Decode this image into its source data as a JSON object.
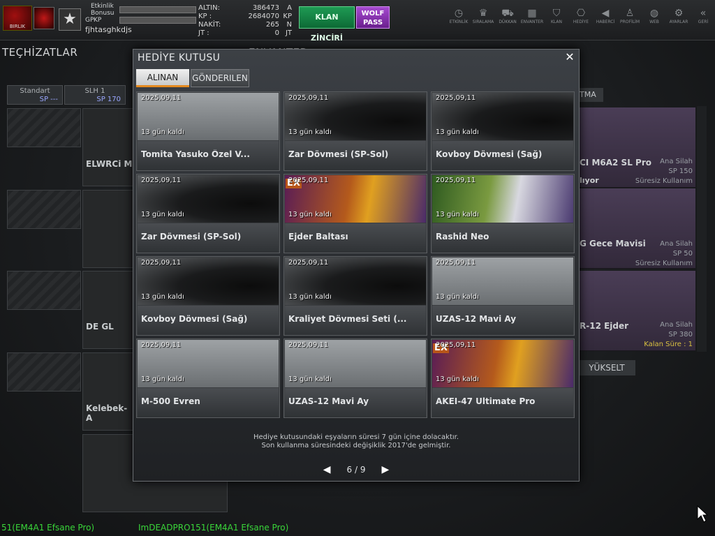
{
  "topbar": {
    "logo_text": "BIRLIK",
    "rank_star": "★",
    "labels": {
      "event_bonus": "Etkinlik Bonusu",
      "kp": "KP",
      "gp": "GP"
    },
    "username": "fjhtasghkdjs",
    "money": [
      {
        "k": "ALTIN:",
        "v": "386473",
        "u": "A"
      },
      {
        "k": "KP  :",
        "v": "2684070",
        "u": "KP"
      },
      {
        "k": "NAKİT:",
        "v": "265",
        "u": "N"
      },
      {
        "k": "JT  :",
        "v": "0",
        "u": "JT"
      }
    ],
    "clan_chain": "KLAN ZİNCİRİ",
    "wolf_pass": "WOLF PASS",
    "nav": [
      {
        "label": "ETKİNLİK",
        "icon": "clock-icon",
        "glyph": "◷"
      },
      {
        "label": "SIRALAMA",
        "icon": "ranking-icon",
        "glyph": "♛"
      },
      {
        "label": "DÜKKAN",
        "icon": "cart-icon",
        "glyph": "⛟"
      },
      {
        "label": "ENVANTER",
        "icon": "inventory-icon",
        "glyph": "▦"
      },
      {
        "label": "KLAN",
        "icon": "clan-icon",
        "glyph": "⛉"
      },
      {
        "label": "HEDİYE",
        "icon": "gift-icon",
        "glyph": "⎔"
      },
      {
        "label": "HABERCİ",
        "icon": "megaphone-icon",
        "glyph": "◀"
      },
      {
        "label": "PROFİLİM",
        "icon": "profile-icon",
        "glyph": "♙"
      },
      {
        "label": "WEB",
        "icon": "globe-icon",
        "glyph": "◍"
      },
      {
        "label": "AYARLAR",
        "icon": "gear-icon",
        "glyph": "⚙"
      },
      {
        "label": "GERİ",
        "icon": "back-icon",
        "glyph": "«"
      }
    ]
  },
  "background": {
    "equipment_title": "TEÇHİZATLAR",
    "inventory_title": "ENVANTER",
    "sub_tabs": [
      {
        "name": "Standart",
        "sp": "SP ---"
      },
      {
        "name": "SLH 1",
        "sp": "SP 170"
      }
    ],
    "slots": [
      "ELWRCi M",
      "DE GL",
      "Kelebek- A"
    ],
    "right_cards": [
      {
        "name": "CI M6A2 SL Pro",
        "line1": "Ana Silah",
        "line2": "SP 150",
        "line3": "Süresiz Kullanım",
        "status": "lıyor"
      },
      {
        "name": "G Gece Mavisi",
        "line1": "Ana Silah",
        "line2": "SP 50",
        "line3": "Süresiz Kullanım"
      },
      {
        "name": "R-12 Ejder",
        "line1": "Ana Silah",
        "line2": "SP 380",
        "line3": "Kalan Süre : 1"
      }
    ],
    "tma_tab": "TMA",
    "upgrade_tab": "YÜKSELT",
    "tickers": [
      "51(EM4A1 Efsane Pro)",
      "ImDEADPRO151(EM4A1 Efsane Pro)"
    ]
  },
  "modal": {
    "title": "HEDİYE KUTUSU",
    "close": "✕",
    "tabs": {
      "received": "ALINAN",
      "sent": "GÖNDERILEN"
    },
    "items": [
      {
        "date": "2025,09,11",
        "days": "13 gün kaldı",
        "name": "Tomita Yasuko Özel V...",
        "bg": "bg-light",
        "ex": false
      },
      {
        "date": "2025,09,11",
        "days": "13 gün kaldı",
        "name": "Zar Dövmesi (SP-Sol)",
        "bg": "bg-dark",
        "ex": false
      },
      {
        "date": "2025,09,11",
        "days": "13 gün kaldı",
        "name": "Kovboy Dövmesi (Sağ)",
        "bg": "bg-dark",
        "ex": false
      },
      {
        "date": "2025,09,11",
        "days": "13 gün kaldı",
        "name": "Zar Dövmesi (SP-Sol)",
        "bg": "bg-dark",
        "ex": false
      },
      {
        "date": "2025,09,11",
        "days": "13 gün kaldı",
        "name": "Ejder Baltası",
        "bg": "bg-fire",
        "ex": true
      },
      {
        "date": "2025,09,11",
        "days": "13 gün kaldı",
        "name": "Rashid Neo",
        "bg": "bg-forest",
        "ex": false
      },
      {
        "date": "2025,09,11",
        "days": "13 gün kaldı",
        "name": "Kovboy Dövmesi (Sağ)",
        "bg": "bg-dark",
        "ex": false
      },
      {
        "date": "2025,09,11",
        "days": "13 gün kaldı",
        "name": "Kraliyet Dövmesi Seti (...",
        "bg": "bg-dark",
        "ex": false
      },
      {
        "date": "2025,09,11",
        "days": "13 gün kaldı",
        "name": "UZAS-12 Mavi Ay",
        "bg": "bg-light",
        "ex": false
      },
      {
        "date": "2025,09,11",
        "days": "13 gün kaldı",
        "name": "M-500 Evren",
        "bg": "bg-light",
        "ex": false
      },
      {
        "date": "2025,09,11",
        "days": "13 gün kaldı",
        "name": "UZAS-12 Mavi Ay",
        "bg": "bg-light",
        "ex": false
      },
      {
        "date": "2025,09,11",
        "days": "13 gün kaldı",
        "name": "AKEI-47 Ultimate Pro",
        "bg": "bg-fire",
        "ex": true
      }
    ],
    "footer_line1": "Hediye kutusundaki eşyaların süresi 7 gün içine dolacaktır.",
    "footer_line2": "Son kullanma süresindeki değişiklik 2017'de gelmiştir.",
    "pager": {
      "prev": "◀",
      "current": "6 / 9",
      "next": "▶"
    },
    "ex_label": "EX"
  }
}
